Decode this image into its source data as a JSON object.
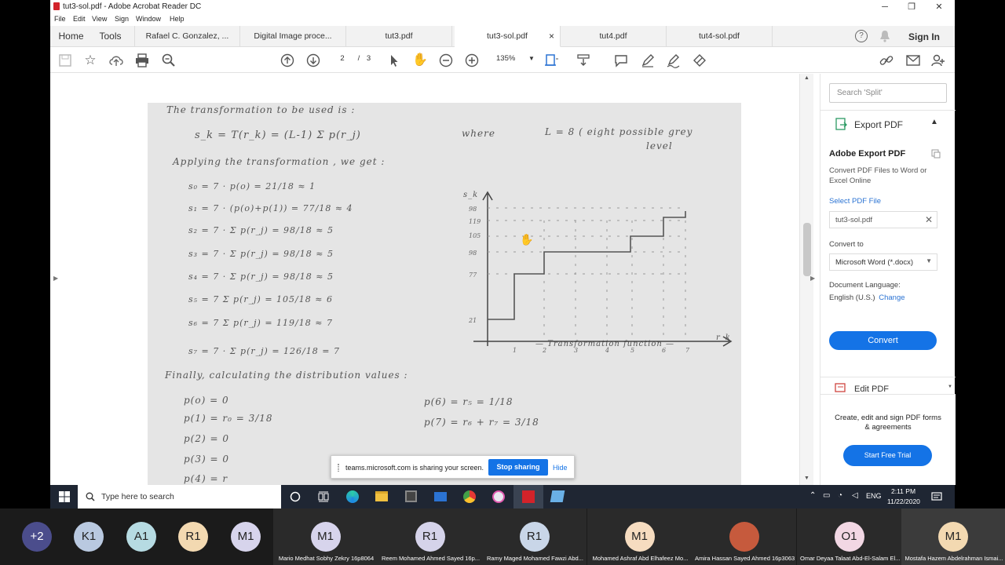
{
  "window": {
    "title": "tut3-sol.pdf - Adobe Acrobat Reader DC",
    "minimize": "─",
    "maximize": "❐",
    "close": "✕"
  },
  "menu": [
    "File",
    "Edit",
    "View",
    "Sign",
    "Window",
    "Help"
  ],
  "tabs": {
    "home": "Home",
    "tools": "Tools",
    "docs": [
      "Rafael C. Gonzalez, ...",
      "Digital Image proce...",
      "tut3.pdf",
      "tut3-sol.pdf",
      "tut4.pdf",
      "tut4-sol.pdf"
    ],
    "active_close": "×",
    "help": "?",
    "sign_in": "Sign In"
  },
  "toolbar": {
    "page_current": "2",
    "page_sep": "/",
    "page_total": "3",
    "zoom": "135%"
  },
  "document": {
    "lines": [
      "The  transformation  to  be  used  is :",
      "s_k = T(r_k) = (L-1) Σ p(r_j)",
      "where",
      "L = 8   ( eight  possible  grey",
      "level",
      "Applying  the  transformation , we  get :",
      "s₀  =  7 · p(o)  =  21/18  ≈  1",
      "s₁  =  7 · (p(o)+p(1))  =  77/18  ≈  4",
      "s₂  =  7 · Σ p(r_j)  =  98/18  ≈  5",
      "s₃  =  7 · Σ p(r_j)  =  98/18  ≈  5",
      "s₄  =  7 · Σ p(r_j)  =  98/18  ≈  5",
      "s₅  =  7  Σ p(r_j)  =  105/18  ≈  6",
      "s₆  =  7  Σ p(r_j)  =  119/18  ≈  7",
      "s₇  =  7 · Σ p(r_j)  =  126/18  =  7",
      "Finally,  calculating   the   distribution  values :",
      "p(o) = 0",
      "p(1) = r₀  =  3/18",
      "p(2) = 0",
      "p(3) = 0",
      "p(4) = r",
      "p(6)  =  r₅  =  1/18",
      "p(7)  =   r₆ + r₇   =  3/18",
      "— Transformation  function —",
      "s_k",
      "r_k"
    ]
  },
  "right_pane": {
    "search_placeholder": "Search 'Split'",
    "export_title": "Export PDF",
    "adobe_export": "Adobe Export PDF",
    "export_desc": "Convert PDF Files to Word or Excel Online",
    "select_file": "Select PDF File",
    "file_name": "tut3-sol.pdf",
    "convert_to": "Convert to",
    "format": "Microsoft Word (*.docx)",
    "doc_lang_label": "Document Language:",
    "doc_lang": "English (U.S.)",
    "change": "Change",
    "convert_btn": "Convert",
    "edit_pdf": "Edit PDF",
    "promo": "Create, edit and sign PDF forms & agreements",
    "trial_btn": "Start Free Trial"
  },
  "share_bar": {
    "message": "teams.microsoft.com is sharing your screen.",
    "stop": "Stop sharing",
    "hide": "Hide"
  },
  "taskbar": {
    "search_placeholder": "Type here to search",
    "lang": "ENG",
    "time": "2:11 PM",
    "date": "11/22/2020"
  },
  "participants": [
    {
      "initials": "+2",
      "name": "",
      "color": "#4b4d8c"
    },
    {
      "initials": "K1",
      "name": "",
      "color": "#b9c9e0"
    },
    {
      "initials": "A1",
      "name": "",
      "color": "#b6dbe2"
    },
    {
      "initials": "R1",
      "name": "",
      "color": "#f3d9b1"
    },
    {
      "initials": "M1",
      "name": "",
      "color": "#d7d4ec"
    },
    {
      "initials": "M1",
      "name": "Mario Medhat Sobhy Zekry 16p8064",
      "color": "#d7d4ec"
    },
    {
      "initials": "R1",
      "name": "Reem Mohamed Ahmed Sayed 16p...",
      "color": "#d5d3ea"
    },
    {
      "initials": "R1",
      "name": "Ramy Maged Mohamed Fawzi Abd...",
      "color": "#c9d6e8"
    },
    {
      "initials": "M1",
      "name": "Mohamed Ashraf Abd Elhafeez Mo...",
      "color": "#f6dcc0"
    },
    {
      "initials": "",
      "name": "Amira Hassan Sayed Ahmed 16p3063",
      "color": "#c65a3d"
    },
    {
      "initials": "O1",
      "name": "Omar Deyaa Talaat Abd-El-Salam El...",
      "color": "#f2d7e4"
    },
    {
      "initials": "M1",
      "name": "Mostafa Hazem Abdelrahman Ismai...",
      "color": "#f3d9b1"
    }
  ]
}
